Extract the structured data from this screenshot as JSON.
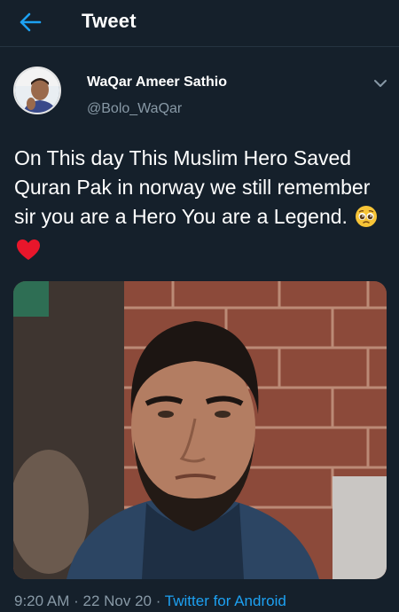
{
  "header": {
    "title": "Tweet",
    "back_icon": "arrow-left-icon"
  },
  "author": {
    "name": "WaQar Ameer Sathio",
    "handle": "@Bolo_WaQar",
    "more_icon": "chevron-down-icon"
  },
  "tweet": {
    "text": "On This day This Muslim Hero Saved Quran Pak in norway we still remember sir you are a Hero You are a Legend.",
    "emojis": [
      "pleading-face-emoji",
      "red-heart-emoji"
    ]
  },
  "meta": {
    "time": "9:20 AM",
    "separator": " · ",
    "date": "22 Nov 20",
    "source": "Twitter for Android"
  },
  "colors": {
    "background": "#15202b",
    "accent": "#1da1f2",
    "secondary_text": "#8899a6",
    "divider": "#253341"
  }
}
